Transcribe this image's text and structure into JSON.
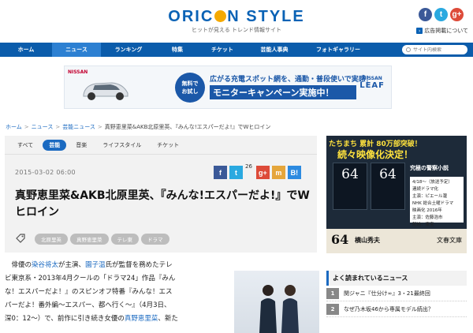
{
  "header": {
    "logo": {
      "part1": "ORIC",
      "part2": "N ST",
      "part3": "LE",
      "y_char": "Y"
    },
    "tagline": "ヒットが見える トレンド情報サイト",
    "social": {
      "fb": "f",
      "tw": "t",
      "gp": "g+"
    },
    "ad_info": "広告掲載について"
  },
  "nav": {
    "items": [
      {
        "label": "ホーム",
        "w": 66
      },
      {
        "label": "ニュース",
        "w": 62
      },
      {
        "label": "ランキング",
        "w": 70
      },
      {
        "label": "特集",
        "w": 54
      },
      {
        "label": "チケット",
        "w": 60
      },
      {
        "label": "芸能人事典",
        "w": 72
      },
      {
        "label": "フォトギャラリー",
        "w": 90
      }
    ],
    "search_placeholder": "サイト内検索"
  },
  "banner": {
    "brand": "NISSAN",
    "badge_line1": "無料で",
    "badge_line2": "お試し",
    "line1": "広がる充電スポット網を、通勤・普段使いで実感！",
    "line2": "モニターキャンペーン実施中！",
    "leaf_a": "NISSAN",
    "leaf_b": "LEAF"
  },
  "breadcrumb": {
    "home": "ホーム",
    "news": "ニュース",
    "geino": "芸能ニュース",
    "current": "真野恵里菜&AKB北原里英、『みんな!エスパーだよ!』でWヒロイン",
    "sep": ">"
  },
  "article": {
    "subtabs": [
      "すべて",
      "芸能",
      "音楽",
      "ライフスタイル",
      "チケット"
    ],
    "active_subtab": 1,
    "date": "2015-03-02 06:00",
    "share": {
      "fb": "f",
      "tw": "t",
      "tw_count": "26",
      "gp": "g+",
      "mx": "m",
      "hb": "B!"
    },
    "title": "真野恵里菜&AKB北原里英、『みんな!エスパーだよ!』でWヒロイン",
    "tags": [
      "北原里英",
      "真野恵里菜",
      "テレ東",
      "ドラマ"
    ],
    "body": {
      "line1_pre": "俳優の",
      "line1_link1": "染谷将太",
      "line1_mid": "が主演、",
      "line1_link2": "園子温",
      "line1_post": "氏が監督を務めたテレ",
      "line2": "ビ東京系・2013年4月クールの「ドラマ24」作品『みん",
      "line3": "な！エスパーだよ！』のスピンオフ特番『みんな！エス",
      "line4": "パーだよ！番外編〜エスパー、都へ行く〜』（4月3日、",
      "line5_pre": "深0：12〜）で、前作に引き続き女優の",
      "line5_link": "真野恵里菜",
      "line5_post": "、新た"
    }
  },
  "side_ad": {
    "h1": "たちまち 累計 80万部突破！",
    "h2": "続々映像化決定！",
    "book1": "64",
    "book2": "64",
    "series": "究極の警察小説",
    "info1": "4/18〜（放送予定）",
    "info2": "連続ドラマ化",
    "info3": "主演：ピエール瀧",
    "info4": "NHK 総合土曜ドラマ",
    "info5": "映画化 2016年",
    "info6": "主演：佐藤浩市",
    "info7": "配給：東宝",
    "bottom_num": "64",
    "author": "横山秀夫",
    "publisher": "文春文庫"
  },
  "most_read": {
    "heading": "よく読まれているニュース",
    "items": [
      {
        "num": "1",
        "text": "関ジャニ『仕分け∞』3・21最終回"
      },
      {
        "num": "2",
        "text": "なぜ乃木坂46から専属モデル続出？"
      }
    ]
  }
}
